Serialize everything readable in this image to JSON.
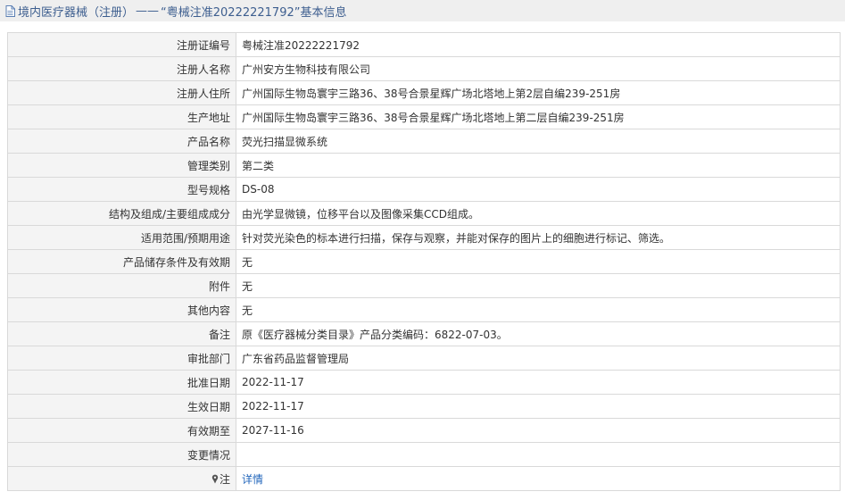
{
  "header": {
    "breadcrumb_root": "境内医疗器械（注册）",
    "separator": "——",
    "record_title": "“粤械注准20222221792”基本信息",
    "icon": "document-icon"
  },
  "rows": [
    {
      "key": "reg-no",
      "label": "注册证编号",
      "value": "粤械注准20222221792"
    },
    {
      "key": "registrant",
      "label": "注册人名称",
      "value": "广州安方生物科技有限公司"
    },
    {
      "key": "registrant-address",
      "label": "注册人住所",
      "value": "广州国际生物岛寰宇三路36、38号合景星辉广场北塔地上第2层自编239-251房"
    },
    {
      "key": "production-address",
      "label": "生产地址",
      "value": "广州国际生物岛寰宇三路36、38号合景星辉广场北塔地上第二层自编239-251房"
    },
    {
      "key": "product-name",
      "label": "产品名称",
      "value": "荧光扫描显微系统"
    },
    {
      "key": "category",
      "label": "管理类别",
      "value": "第二类"
    },
    {
      "key": "model",
      "label": "型号规格",
      "value": "DS-08"
    },
    {
      "key": "structure",
      "label": "结构及组成/主要组成成分",
      "value": "由光学显微镜，位移平台以及图像采集CCD组成。"
    },
    {
      "key": "intended-use",
      "label": "适用范围/预期用途",
      "value": "针对荧光染色的标本进行扫描，保存与观察，并能对保存的图片上的细胞进行标记、筛选。"
    },
    {
      "key": "storage",
      "label": "产品储存条件及有效期",
      "value": "无"
    },
    {
      "key": "attachment",
      "label": "附件",
      "value": "无"
    },
    {
      "key": "other",
      "label": "其他内容",
      "value": "无"
    },
    {
      "key": "remark",
      "label": "备注",
      "value": "原《医疗器械分类目录》产品分类编码：6822-07-03。"
    },
    {
      "key": "approval-dept",
      "label": "审批部门",
      "value": "广东省药品监督管理局"
    },
    {
      "key": "approval-date",
      "label": "批准日期",
      "value": "2022-11-17"
    },
    {
      "key": "effective-date",
      "label": "生效日期",
      "value": "2022-11-17"
    },
    {
      "key": "expiry-date",
      "label": "有效期至",
      "value": "2027-11-16"
    },
    {
      "key": "changes",
      "label": "变更情况",
      "value": ""
    }
  ],
  "note_row": {
    "label": "注",
    "icon": "pin-icon",
    "link_text": "详情"
  },
  "colors": {
    "title_bg": "#efefef",
    "title_text": "#3d5e8f",
    "label_bg": "#f4f4f4",
    "border": "#d9d9d9",
    "link": "#2266bb"
  }
}
